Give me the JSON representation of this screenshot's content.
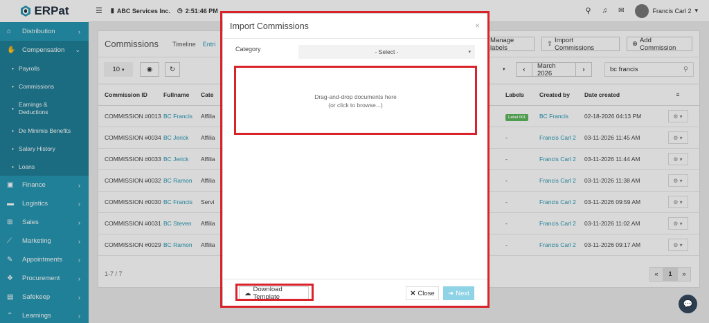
{
  "app": {
    "logo": "ERPat"
  },
  "topbar": {
    "company": "ABC Services Inc.",
    "time": "2:51:46 PM",
    "user": "Francis Carl 2"
  },
  "sidebar": {
    "items": [
      {
        "label": "Distribution",
        "icon": "bank-icon"
      },
      {
        "label": "Compensation",
        "icon": "handshake-icon"
      },
      {
        "label": "Finance",
        "icon": "money-icon"
      },
      {
        "label": "Logistics",
        "icon": "truck-icon"
      },
      {
        "label": "Sales",
        "icon": "cart-icon"
      },
      {
        "label": "Marketing",
        "icon": "chart-line-icon"
      },
      {
        "label": "Appointments",
        "icon": "edit-icon"
      },
      {
        "label": "Procurement",
        "icon": "cubes-icon"
      },
      {
        "label": "Safekeep",
        "icon": "archive-icon"
      },
      {
        "label": "Learnings",
        "icon": "graduation-icon"
      }
    ],
    "sub": [
      "Payrolls",
      "Commissions",
      "Earnings & Deductions",
      "De Minimis Benefits",
      "Salary History",
      "Loans"
    ]
  },
  "page": {
    "title": "Commissions",
    "tabs": [
      "Timeline",
      "Entri"
    ],
    "manage_labels": "Manage labels",
    "import_btn": "Import Commissions",
    "add_btn": "Add Commission",
    "page_size": "10",
    "month": "March 2026",
    "search_value": "bc francis",
    "pagination_info": "1-7 / 7",
    "page_num": "1",
    "prev": "«",
    "next": "»"
  },
  "table": {
    "headers": [
      "Commission ID",
      "Fullname",
      "Cate",
      "Labels",
      "Created by",
      "Date created"
    ],
    "rows": [
      {
        "id": "COMMISSION #0013",
        "name": "BC Francis",
        "cat": "Affilia",
        "label": "Label 001",
        "by": "BC Francis",
        "date": "02-18-2026 04:13 PM"
      },
      {
        "id": "COMMISSION #0034",
        "name": "BC Jerick",
        "cat": "Affilia",
        "label": "-",
        "by": "Francis Carl 2",
        "date": "03-11-2026 11:45 AM"
      },
      {
        "id": "COMMISSION #0033",
        "name": "BC Jerick",
        "cat": "Affilia",
        "label": "-",
        "by": "Francis Carl 2",
        "date": "03-11-2026 11:44 AM"
      },
      {
        "id": "COMMISSION #0032",
        "name": "BC Ramon",
        "cat": "Affilia",
        "label": "-",
        "by": "Francis Carl 2",
        "date": "03-11-2026 11:38 AM"
      },
      {
        "id": "COMMISSION #0030",
        "name": "BC Francis",
        "cat": "Servi",
        "label": "-",
        "by": "Francis Carl 2",
        "date": "03-11-2026 09:59 AM"
      },
      {
        "id": "COMMISSION #0031",
        "name": "BC Steven",
        "cat": "Affilia",
        "label": "-",
        "by": "Francis Carl 2",
        "date": "03-11-2026 11:02 AM"
      },
      {
        "id": "COMMISSION #0029",
        "name": "BC Ramon",
        "cat": "Affilia",
        "label": "-",
        "by": "Francis Carl 2",
        "date": "03-11-2026 09:17 AM"
      }
    ]
  },
  "modal": {
    "title": "Import Commissions",
    "category_label": "Category",
    "select_value": "- Select -",
    "drop_line1": "Drag-and-drop documents here",
    "drop_line2": "(or click to browse...)",
    "download": "Download Template",
    "close": "Close",
    "next": "Next"
  },
  "colors": {
    "sidebar": "#2697b3",
    "highlight": "#d9222a",
    "link": "#2697b3",
    "label_green": "#5cb85c"
  }
}
